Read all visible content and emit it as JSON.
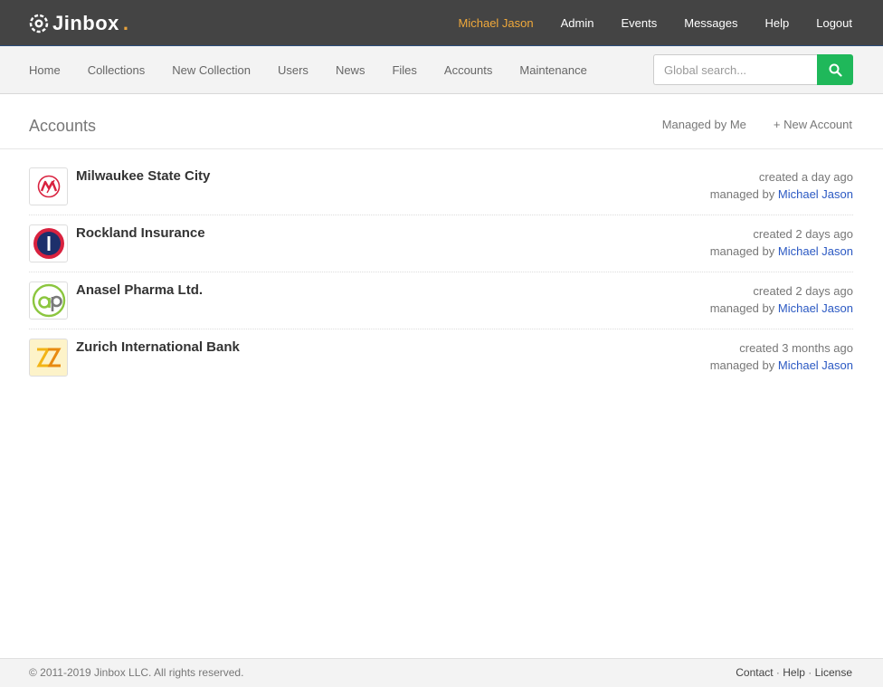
{
  "brand": {
    "name": "Jinbox",
    "dot": ".",
    "accent_color": "#e8a33d"
  },
  "topnav": {
    "user": "Michael Jason",
    "items": [
      "Admin",
      "Events",
      "Messages",
      "Help",
      "Logout"
    ]
  },
  "subnav": {
    "items": [
      "Home",
      "Collections",
      "New Collection",
      "Users",
      "News",
      "Files",
      "Accounts",
      "Maintenance"
    ]
  },
  "search": {
    "placeholder": "Global search...",
    "icon": "search-icon",
    "button_color": "#1fb85a"
  },
  "page": {
    "title": "Accounts",
    "actions": [
      "Managed by Me",
      "+ New Account"
    ]
  },
  "accounts": [
    {
      "name": "Milwaukee State City",
      "created": "created a day ago",
      "managed_prefix": "managed by",
      "manager": "Michael Jason",
      "logo": "milwaukee-logo"
    },
    {
      "name": "Rockland Insurance",
      "created": "created 2 days ago",
      "managed_prefix": "managed by",
      "manager": "Michael Jason",
      "logo": "rockland-logo"
    },
    {
      "name": "Anasel Pharma Ltd.",
      "created": "created 2 days ago",
      "managed_prefix": "managed by",
      "manager": "Michael Jason",
      "logo": "anasel-logo"
    },
    {
      "name": "Zurich International Bank",
      "created": "created 3 months ago",
      "managed_prefix": "managed by",
      "manager": "Michael Jason",
      "logo": "zurich-logo"
    }
  ],
  "footer": {
    "copyright": "© 2011-2019 Jinbox LLC. All rights reserved.",
    "links": [
      "Contact",
      "Help",
      "License"
    ],
    "separator": " · "
  }
}
